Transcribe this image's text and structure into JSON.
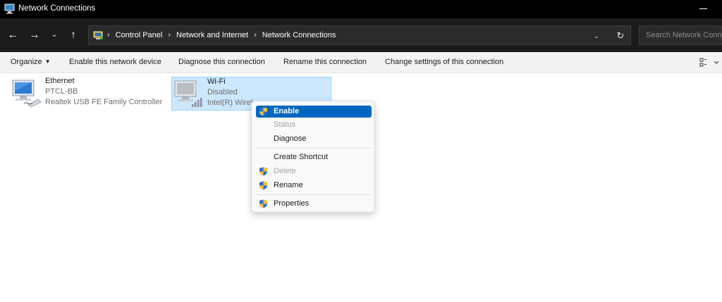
{
  "window": {
    "title": "Network Connections"
  },
  "address": {
    "crumbs": [
      "Control Panel",
      "Network and Internet",
      "Network Connections"
    ],
    "search_placeholder": "Search Network Connections"
  },
  "commands": {
    "organize": "Organize",
    "enable_device": "Enable this network device",
    "diagnose": "Diagnose this connection",
    "rename": "Rename this connection",
    "change_settings": "Change settings of this connection"
  },
  "connections": [
    {
      "name": "Ethernet",
      "network": "PTCL-BB",
      "device": "Realtek USB FE Family Controller"
    },
    {
      "name": "Wi-Fi",
      "network": "Disabled",
      "device": "Intel(R) Wirel"
    }
  ],
  "context_menu": {
    "items": [
      {
        "label": "Enable",
        "icon": "shield-icon",
        "state": "highlighted"
      },
      {
        "label": "Status",
        "state": "disabled"
      },
      {
        "label": "Diagnose",
        "state": "normal"
      },
      {
        "label": "Create Shortcut",
        "state": "normal"
      },
      {
        "label": "Delete",
        "icon": "shield-icon",
        "state": "disabled"
      },
      {
        "label": "Rename",
        "icon": "shield-icon",
        "state": "normal"
      },
      {
        "label": "Properties",
        "icon": "shield-icon",
        "state": "normal"
      }
    ]
  },
  "colors": {
    "titlebar": "#000000",
    "addressbar": "#1b1b1b",
    "selection": "#cce8ff",
    "menu_highlight": "#0067c0"
  }
}
